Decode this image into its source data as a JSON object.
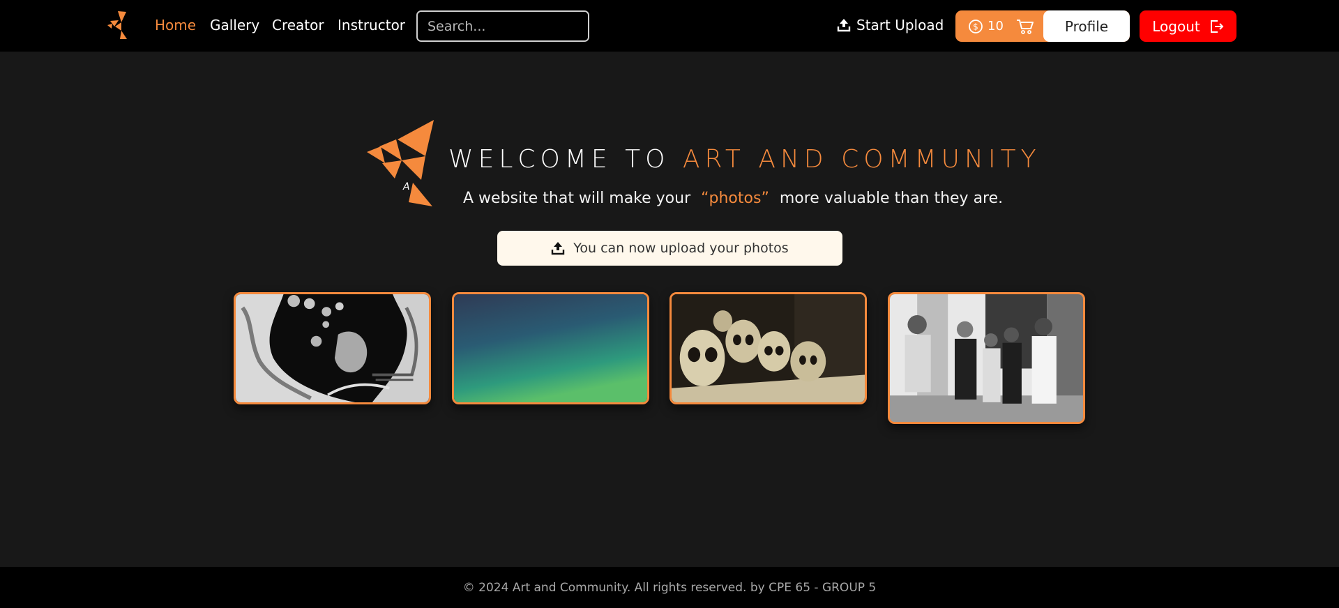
{
  "nav": {
    "links": [
      "Home",
      "Gallery",
      "Creator",
      "Instructor"
    ],
    "search_placeholder": "Search...",
    "upload_label": "Start Upload",
    "coins": "10",
    "profile_label": "Profile",
    "logout_label": "Logout"
  },
  "hero": {
    "title_prefix": "WELCOME TO",
    "title_accent": "ART AND COMMUNITY",
    "subtitle_before": "A website that will make your",
    "subtitle_accent": "“photos”",
    "subtitle_after": "more valuable than they are.",
    "cta_label": "You can now upload your photos"
  },
  "gallery": {
    "items": [
      "abstract-bw-photo",
      "gradient-blue-green-photo",
      "skulls-sepia-photo",
      "band-group-bw-photo"
    ]
  },
  "footer": {
    "text": "© 2024 Art and Community. All rights reserved. by CPE 65 - GROUP 5"
  },
  "colors": {
    "accent": "#f58a3d",
    "logout": "#ff0000",
    "background": "#181818",
    "nav_bg": "#000000"
  }
}
